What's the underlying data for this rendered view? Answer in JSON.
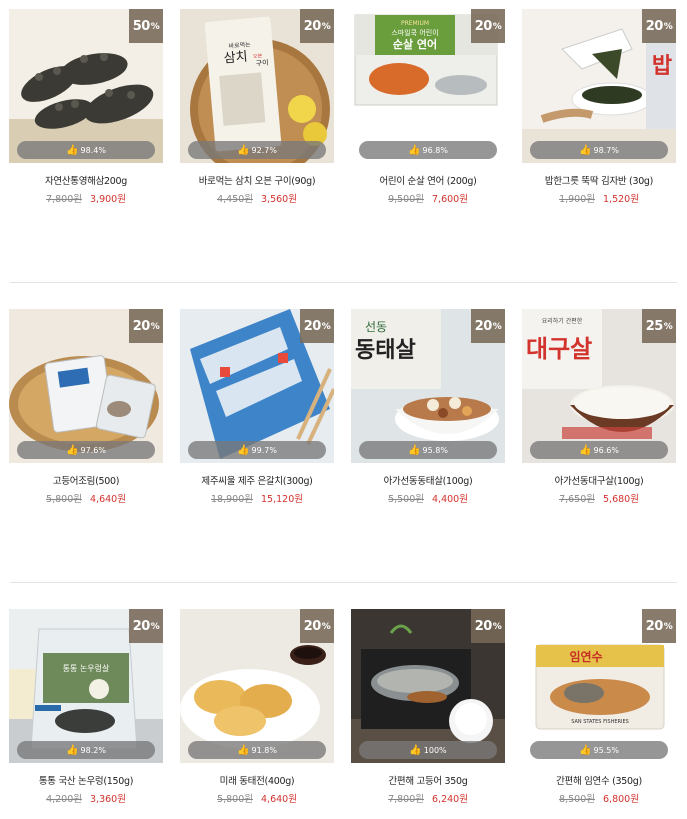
{
  "colors": {
    "badge_bg": "#786958",
    "sale_price": "#d2332d",
    "like_bar": "#7a7a7a",
    "divider": "#e4e4e4"
  },
  "rows": [
    [
      {
        "discount": "50",
        "pct": "%",
        "like": "98.4%",
        "title": "자연산통영해삼200g",
        "orig": "7,800원",
        "sale": "3,900원",
        "img": "sea-cucumber"
      },
      {
        "discount": "20",
        "pct": "%",
        "like": "92.7%",
        "title": "바로먹는 삼치 오븐 구이(90g)",
        "orig": "4,450원",
        "sale": "3,560원",
        "img": "mackerel-pack",
        "pack_text": "바로먹는",
        "pack_name": "삼치",
        "pack_tag": "오븐",
        "pack_end": "구이"
      },
      {
        "discount": "20",
        "pct": "%",
        "like": "96.8%",
        "title": "어린이 순살 연어 (200g)",
        "orig": "9,500원",
        "sale": "7,600원",
        "img": "salmon-box",
        "box_top": "PREMIUM",
        "box_sub": "스마일쿡 어린이",
        "box_name": "순살 연어"
      },
      {
        "discount": "20",
        "pct": "%",
        "like": "98.7%",
        "title": "밥한그릇 뚝딱 김자반 (30g)",
        "orig": "1,900원",
        "sale": "1,520원",
        "img": "seaweed",
        "can_text": "밥"
      }
    ],
    [
      {
        "discount": "20",
        "pct": "%",
        "like": "97.6%",
        "title": "고등어조림(500)",
        "orig": "5,800원",
        "sale": "4,640원",
        "img": "basket"
      },
      {
        "discount": "20",
        "pct": "%",
        "like": "99.7%",
        "title": "제주씨울 제주 은갈치(300g)",
        "orig": "18,900원",
        "sale": "15,120원",
        "img": "hairtail"
      },
      {
        "discount": "20",
        "pct": "%",
        "like": "95.8%",
        "title": "아가선동동태살(100g)",
        "orig": "5,500원",
        "sale": "4,400원",
        "img": "pollack-bowl",
        "box_a": "선동",
        "box_b": "동태살"
      },
      {
        "discount": "25",
        "pct": "%",
        "like": "96.6%",
        "title": "아가선동대구살(100g)",
        "orig": "7,650원",
        "sale": "5,680원",
        "img": "porridge",
        "box_c": "대구살",
        "box_small": "요리하기 간편한"
      }
    ],
    [
      {
        "discount": "20",
        "pct": "%",
        "like": "98.2%",
        "title": "통통 국산 논우렁(150g)",
        "orig": "4,200원",
        "sale": "3,360원",
        "img": "snail-bag",
        "bag_text": "통통 논우렁살"
      },
      {
        "discount": "20",
        "pct": "%",
        "like": "91.8%",
        "title": "미래 동태전(400g)",
        "orig": "5,800원",
        "sale": "4,640원",
        "img": "pancake"
      },
      {
        "discount": "20",
        "pct": "%",
        "like": "100%",
        "title": "간편해 고등어 350g",
        "orig": "7,800원",
        "sale": "6,240원",
        "img": "grilled-fish"
      },
      {
        "discount": "20",
        "pct": "%",
        "like": "95.5%",
        "title": "간편해 임연수 (350g)",
        "orig": "8,500원",
        "sale": "6,800원",
        "img": "fish-pack",
        "pack_label": "임연수",
        "pack_bottom": "SAN STATES FISHERIES"
      }
    ]
  ]
}
